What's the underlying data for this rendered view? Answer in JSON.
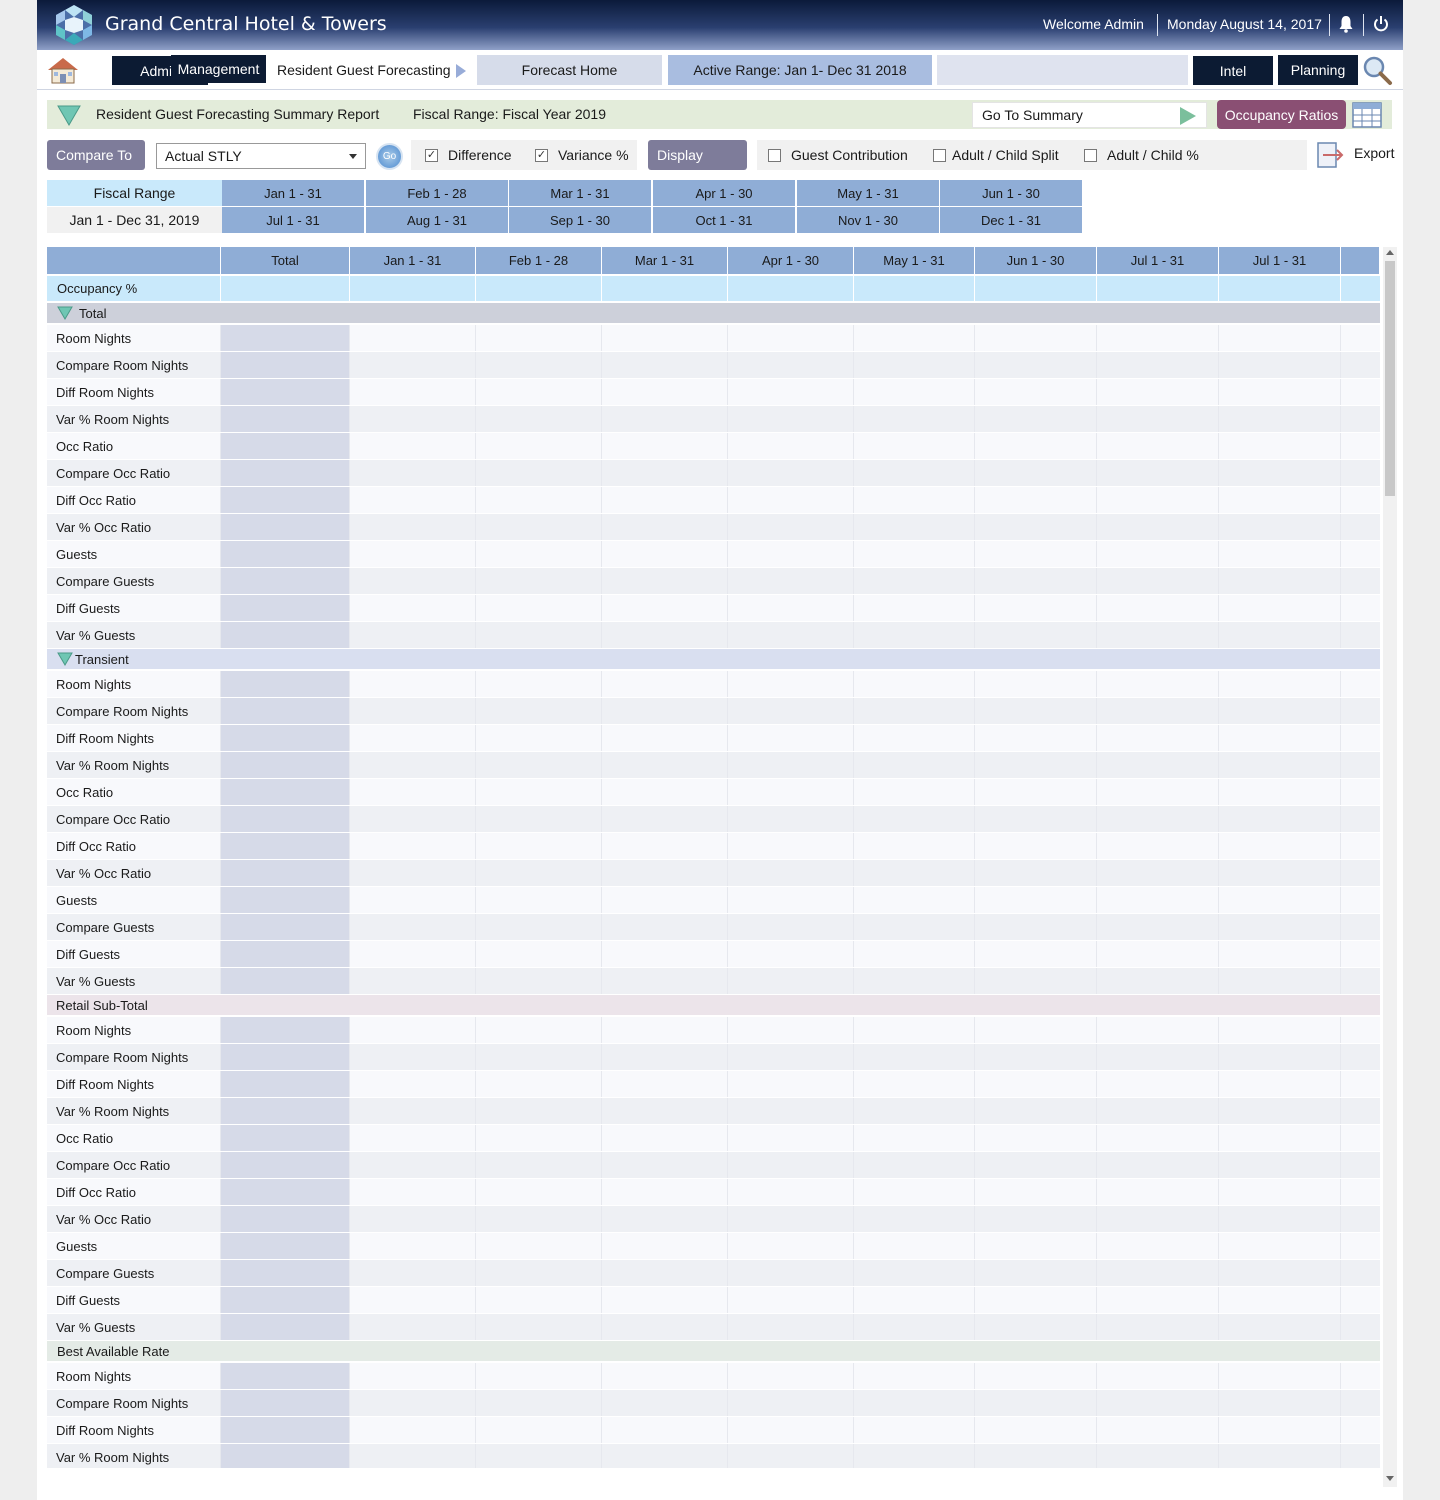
{
  "header": {
    "title": "Grand Central Hotel & Towers",
    "welcome": "Welcome Admin",
    "date": "Monday August 14, 2017",
    "icons": [
      "hotel-logo-icon",
      "bell-icon",
      "power-icon"
    ]
  },
  "nav": {
    "admin": "Admin",
    "management": "Management",
    "breadcrumb": "Resident Guest Forecasting",
    "forecast_home": "Forecast Home",
    "active_range": "Active Range: Jan 1- Dec 31 2018",
    "intel": "Intel",
    "planning": "Planning",
    "icons": [
      "home-icon",
      "search-icon"
    ]
  },
  "report": {
    "title": "Resident Guest Forecasting Summary Report",
    "fiscal_range": "Fiscal Range: Fiscal Year 2019",
    "goto": "Go To Summary",
    "occupancy_ratios": "Occupancy Ratios"
  },
  "controls": {
    "compare_to": "Compare To",
    "compare_value": "Actual STLY",
    "go": "Go",
    "difference": "Difference",
    "difference_checked": true,
    "variance": "Variance %",
    "variance_checked": true,
    "display": "Display",
    "guest_contribution": "Guest Contribution",
    "guest_contribution_checked": false,
    "adult_child_split": "Adult / Child Split",
    "adult_child_split_checked": false,
    "adult_child_pct": "Adult / Child %",
    "adult_child_pct_checked": false,
    "export": "Export"
  },
  "fiscal_grid": {
    "label_top": "Fiscal Range",
    "label_bottom": "Jan 1 - Dec 31, 2019",
    "row1": [
      "Jan 1 - 31",
      "Feb 1 - 28",
      "Mar 1 - 31",
      "Apr 1 - 30",
      "May 1 - 31",
      "Jun 1 - 30"
    ],
    "row2": [
      "Jul 1 - 31",
      "Aug 1 - 31",
      "Sep 1 - 30",
      "Oct 1 - 31",
      "Nov 1 - 30",
      "Dec 1 - 31"
    ]
  },
  "table": {
    "columns": [
      "Total",
      "Jan 1 - 31",
      "Feb 1 - 28",
      "Mar 1 - 31",
      "Apr 1 - 30",
      "May 1 - 31",
      "Jun 1 - 30",
      "Jul 1 - 31",
      "Jul 1 - 31"
    ],
    "occupancy_label": "Occupancy %",
    "sections": [
      {
        "label": "Total",
        "rows": [
          "Room Nights",
          "Compare Room Nights",
          "Diff Room Nights",
          "Var % Room Nights",
          "Occ Ratio",
          "Compare Occ Ratio",
          "Diff Occ Ratio",
          "Var % Occ Ratio",
          "Guests",
          "Compare Guests",
          "Diff Guests",
          "Var % Guests"
        ]
      },
      {
        "label": "Transient",
        "rows": [
          "Room Nights",
          "Compare Room Nights",
          "Diff Room Nights",
          "Var % Room Nights",
          "Occ Ratio",
          "Compare Occ Ratio",
          "Diff Occ Ratio",
          "Var % Occ Ratio",
          "Guests",
          "Compare Guests",
          "Diff Guests",
          "Var % Guests"
        ]
      },
      {
        "label": "Retail Sub-Total",
        "rows": [
          "Room Nights",
          "Compare Room Nights",
          "Diff Room Nights",
          "Var % Room Nights",
          "Occ Ratio",
          "Compare Occ Ratio",
          "Diff Occ Ratio",
          "Var % Occ Ratio",
          "Guests",
          "Compare Guests",
          "Diff Guests",
          "Var % Guests"
        ]
      },
      {
        "label": "Best Available Rate",
        "rows": [
          "Room Nights",
          "Compare Room Nights",
          "Diff Room Nights",
          "Var % Room Nights"
        ]
      }
    ]
  },
  "colors": {
    "nav_dark": "#0c1b33",
    "header_blue": "#8fadd6",
    "accent_purple": "#8a4f73",
    "teal_triangle": "#6fc6b3"
  }
}
